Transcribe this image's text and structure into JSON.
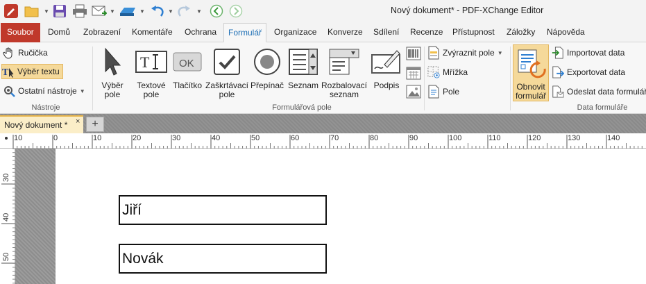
{
  "app": {
    "window_title": "Nový dokument* - PDF-XChange Editor"
  },
  "menu_tabs": [
    {
      "label": "Soubor"
    },
    {
      "label": "Domů"
    },
    {
      "label": "Zobrazení"
    },
    {
      "label": "Komentáře"
    },
    {
      "label": "Ochrana"
    },
    {
      "label": "Formulář"
    },
    {
      "label": "Organizace"
    },
    {
      "label": "Konverze"
    },
    {
      "label": "Sdílení"
    },
    {
      "label": "Recenze"
    },
    {
      "label": "Přístupnost"
    },
    {
      "label": "Záložky"
    },
    {
      "label": "Nápověda"
    }
  ],
  "ribbon": {
    "tools": {
      "hand": "Ručička",
      "select_text": "Výběr textu",
      "other_tools": "Ostatní nástroje",
      "group_label": "Nástroje"
    },
    "form_fields": {
      "select_field": [
        "Výběr",
        "pole"
      ],
      "text_field": [
        "Textové",
        "pole"
      ],
      "button": "Tlačítko",
      "checkbox": [
        "Zaškrtávací",
        "pole"
      ],
      "radio": "Přepínač",
      "list": "Seznam",
      "dropdown": [
        "Rozbalovací",
        "seznam"
      ],
      "signature": "Podpis",
      "group_label": "Formulářová pole"
    },
    "field_options": {
      "highlight": "Zvýraznit pole",
      "grid": "Mřížka",
      "fields": "Pole"
    },
    "form_data": {
      "reset_form": [
        "Obnovit",
        "formulář"
      ],
      "import": "Importovat data",
      "export": "Exportovat data",
      "submit": "Odeslat data formuláře",
      "group_label": "Data formuláře"
    }
  },
  "document_tab": {
    "label": "Nový dokument *",
    "close": "×",
    "new_tab": "+"
  },
  "ruler": {
    "h_ticks": [
      "10",
      "0",
      "10",
      "20",
      "30",
      "40",
      "50",
      "60",
      "70",
      "80",
      "90",
      "100",
      "110",
      "120",
      "130",
      "140"
    ],
    "v_ticks": [
      "30",
      "40",
      "50"
    ]
  },
  "form": {
    "first_name": "Jiří",
    "last_name": "Novák"
  },
  "colors": {
    "accent": "#1e6fb5",
    "file_tab": "#c0392b",
    "selected": "#f5d99a"
  }
}
